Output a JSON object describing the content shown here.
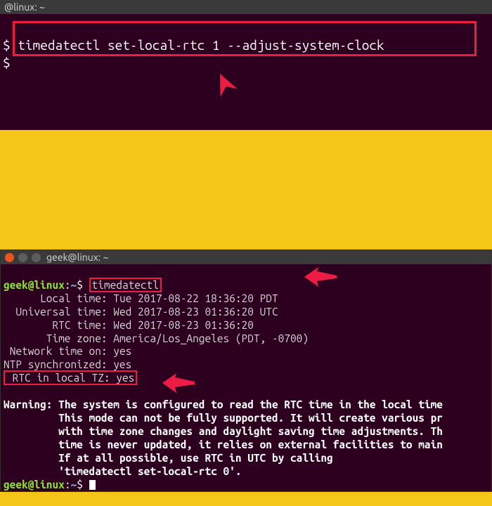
{
  "top_terminal": {
    "title": "@linux: ~",
    "prompt1_sym": "$",
    "command": "timedatectl set-local-rtc 1 --adjust-system-clock",
    "prompt2_sym": "$"
  },
  "bottom_terminal": {
    "title": "geek@linux: ~",
    "prompt_user": "geek@linux",
    "prompt_path": "~",
    "prompt_sym": "$",
    "command": "timedatectl",
    "output": {
      "local_time_label": "Local time:",
      "local_time_value": "Tue 2017-08-22 18:36:20 PDT",
      "universal_time_label": "Universal time:",
      "universal_time_value": "Wed 2017-08-23 01:36:20 UTC",
      "rtc_time_label": "RTC time:",
      "rtc_time_value": "Wed 2017-08-23 01:36:20",
      "time_zone_label": "Time zone:",
      "time_zone_value": "America/Los_Angeles (PDT, -0700)",
      "network_time_label": "Network time on:",
      "network_time_value": "yes",
      "ntp_sync_label": "NTP synchronized:",
      "ntp_sync_value": "yes",
      "rtc_local_label": "RTC in local TZ:",
      "rtc_local_value": "yes"
    },
    "warning_label": "Warning:",
    "warning_lines": [
      "The system is configured to read the RTC time in the local time",
      "This mode can not be fully supported. It will create various pr",
      "with time zone changes and daylight saving time adjustments. Th",
      "time is never updated, it relies on external facilities to main",
      "If at all possible, use RTC in UTC by calling",
      "'timedatectl set-local-rtc 0'."
    ]
  }
}
